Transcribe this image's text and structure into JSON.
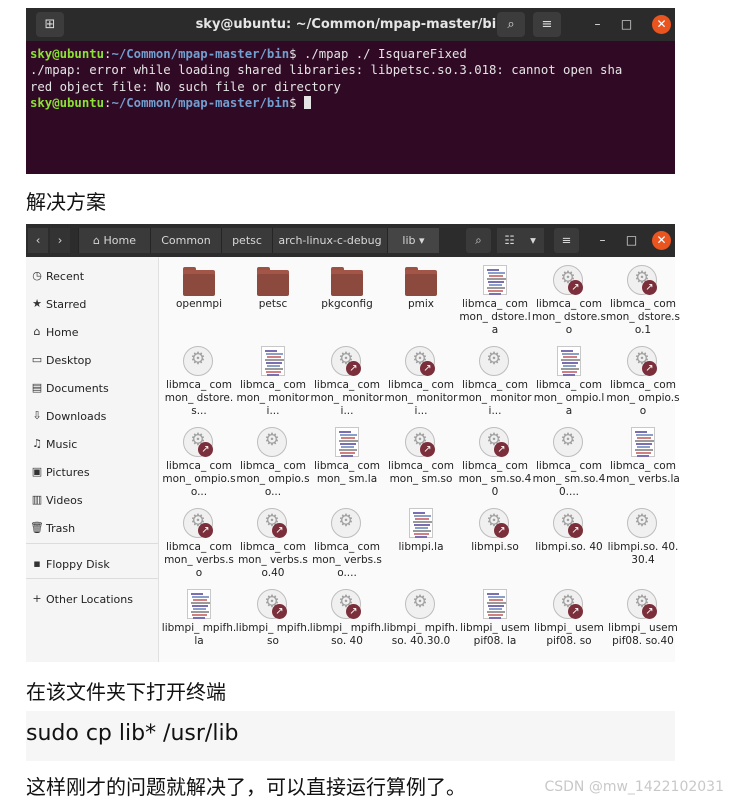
{
  "terminal": {
    "title": "sky@ubuntu: ~/Common/mpap-master/bin",
    "new_tab_glyph": "⊞",
    "search_glyph": "⌕",
    "menu_glyph": "≡",
    "minimize_glyph": "–",
    "maximize_glyph": "□",
    "close_glyph": "✕",
    "lines": [
      {
        "user": "sky@ubuntu",
        "sep": ":",
        "path": "~/Common/mpap-master/bin",
        "rest": "$ ./mpap ./ IsquareFixed"
      },
      {
        "text": "./mpap: error while loading shared libraries: libpetsc.so.3.018: cannot open sha"
      },
      {
        "text": "red object file: No such file or directory"
      },
      {
        "user": "sky@ubuntu",
        "sep": ":",
        "path": "~/Common/mpap-master/bin",
        "rest": "$ "
      }
    ]
  },
  "caption1": "解决方案",
  "file_manager": {
    "back_glyph": "‹",
    "forward_glyph": "›",
    "home_glyph": "⌂",
    "breadcrumbs": [
      "Home",
      "Common",
      "petsc",
      "arch-linux-c-debug",
      "lib"
    ],
    "dropdown_glyph": "▾",
    "search_glyph": "⌕",
    "view_glyph": "☷",
    "menu_glyph": "≡",
    "minimize_glyph": "–",
    "maximize_glyph": "□",
    "close_glyph": "✕",
    "sidebar": [
      {
        "label": "Recent",
        "icon": "clock-icon",
        "glyph": "◷"
      },
      {
        "label": "Starred",
        "icon": "star-icon",
        "glyph": "★"
      },
      {
        "label": "Home",
        "icon": "home-icon",
        "glyph": "⌂"
      },
      {
        "label": "Desktop",
        "icon": "desktop-icon",
        "glyph": "▭"
      },
      {
        "label": "Documents",
        "icon": "documents-icon",
        "glyph": "▤"
      },
      {
        "label": "Downloads",
        "icon": "downloads-icon",
        "glyph": "⇩"
      },
      {
        "label": "Music",
        "icon": "music-icon",
        "glyph": "♫"
      },
      {
        "label": "Pictures",
        "icon": "pictures-icon",
        "glyph": "▣"
      },
      {
        "label": "Videos",
        "icon": "videos-icon",
        "glyph": "▥"
      },
      {
        "label": "Trash",
        "icon": "trash-icon",
        "glyph": "🗑"
      },
      {
        "label": "Floppy Disk",
        "icon": "floppy-icon",
        "glyph": "▪"
      },
      {
        "label": "Other Locations",
        "icon": "plus-icon",
        "glyph": "+"
      }
    ],
    "files": [
      {
        "name": "openmpi",
        "kind": "folder"
      },
      {
        "name": "petsc",
        "kind": "folder"
      },
      {
        "name": "pkgconfig",
        "kind": "folder"
      },
      {
        "name": "pmix",
        "kind": "folder"
      },
      {
        "name": "libmca_ common_ dstore.la",
        "kind": "doc"
      },
      {
        "name": "libmca_ common_ dstore.so",
        "kind": "link"
      },
      {
        "name": "libmca_ common_ dstore.so.1",
        "kind": "link"
      },
      {
        "name": "libmca_ common_ dstore.s...",
        "kind": "lib"
      },
      {
        "name": "libmca_ common_ monitori...",
        "kind": "doc"
      },
      {
        "name": "libmca_ common_ monitori...",
        "kind": "link"
      },
      {
        "name": "libmca_ common_ monitori...",
        "kind": "link"
      },
      {
        "name": "libmca_ common_ monitori...",
        "kind": "lib"
      },
      {
        "name": "libmca_ common_ ompio.la",
        "kind": "doc"
      },
      {
        "name": "libmca_ common_ ompio.so",
        "kind": "link"
      },
      {
        "name": "libmca_ common_ ompio.so...",
        "kind": "link"
      },
      {
        "name": "libmca_ common_ ompio.so...",
        "kind": "lib"
      },
      {
        "name": "libmca_ common_ sm.la",
        "kind": "doc"
      },
      {
        "name": "libmca_ common_ sm.so",
        "kind": "link"
      },
      {
        "name": "libmca_ common_ sm.so.40",
        "kind": "link"
      },
      {
        "name": "libmca_ common_ sm.so.40....",
        "kind": "lib"
      },
      {
        "name": "libmca_ common_ verbs.la",
        "kind": "doc"
      },
      {
        "name": "libmca_ common_ verbs.so",
        "kind": "link"
      },
      {
        "name": "libmca_ common_ verbs.so.40",
        "kind": "link"
      },
      {
        "name": "libmca_ common_ verbs.so....",
        "kind": "lib"
      },
      {
        "name": "libmpi.la",
        "kind": "doc"
      },
      {
        "name": "libmpi.so",
        "kind": "link"
      },
      {
        "name": "libmpi.so. 40",
        "kind": "link"
      },
      {
        "name": "libmpi.so. 40.30.4",
        "kind": "lib"
      },
      {
        "name": "libmpi_ mpifh.la",
        "kind": "doc"
      },
      {
        "name": "libmpi_ mpifh.so",
        "kind": "link"
      },
      {
        "name": "libmpi_ mpifh.so. 40",
        "kind": "link"
      },
      {
        "name": "libmpi_ mpifh.so. 40.30.0",
        "kind": "lib"
      },
      {
        "name": "libmpi_ usempif08. la",
        "kind": "doc"
      },
      {
        "name": "libmpi_ usempif08. so",
        "kind": "link"
      },
      {
        "name": "libmpi_ usempif08. so.40",
        "kind": "link"
      }
    ]
  },
  "caption2": "在该文件夹下打开终端",
  "command": "sudo cp lib* /usr/lib",
  "caption3": "这样刚才的问题就解决了，可以直接运行算例了。",
  "watermark": "CSDN @mw_1422102031",
  "colors": {
    "terminal_bg": "#300a24",
    "prompt_user": "#8ae234",
    "prompt_path": "#729fcf",
    "folder": "#9c5243",
    "link_badge": "#7b2f3b",
    "close": "#e9541f"
  }
}
